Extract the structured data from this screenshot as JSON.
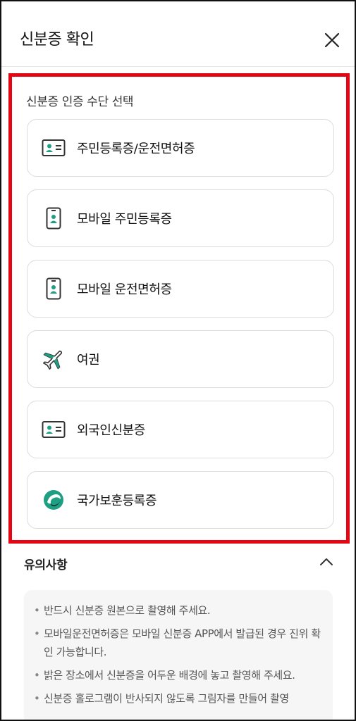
{
  "header": {
    "title": "신분증 확인",
    "close_icon": "close-icon"
  },
  "methods": {
    "section_label": "신분증 인증 수단 선택",
    "items": [
      {
        "label": "주민등록증/운전면허증",
        "icon": "id-card-icon"
      },
      {
        "label": "모바일 주민등록증",
        "icon": "mobile-id-icon"
      },
      {
        "label": "모바일 운전면허증",
        "icon": "mobile-id-icon"
      },
      {
        "label": "여권",
        "icon": "airplane-icon"
      },
      {
        "label": "외국인신분증",
        "icon": "id-card-icon"
      },
      {
        "label": "국가보훈등록증",
        "icon": "patriot-emblem-icon"
      }
    ]
  },
  "notes": {
    "title": "유의사항",
    "toggle_icon": "chevron-up-icon",
    "bullet": "•",
    "items": [
      "반드시 신분증 원본으로 촬영해 주세요.",
      "모바일운전면허증은 모바일 신분증 APP에서 발급된 경우 진위 확인 가능합니다.",
      "밝은 장소에서 신분증을 어두운 배경에 놓고 촬영해 주세요.",
      "신분증 홀로그램이 반사되지 않도록 그림자를 만들어 촬영"
    ]
  },
  "colors": {
    "accent_green": "#1e9e82",
    "highlight_red": "#e30613",
    "icon_dark": "#333333"
  }
}
